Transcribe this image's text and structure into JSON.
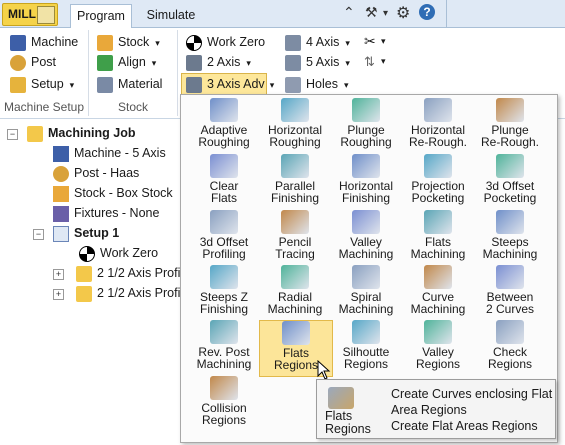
{
  "app": {
    "button_label": "MILL"
  },
  "tabs": [
    {
      "label": "Program"
    },
    {
      "label": "Simulate"
    }
  ],
  "ribbon": {
    "machine_setup": {
      "items": [
        "Machine",
        "Post",
        "Setup"
      ],
      "group_label": "Machine Setup"
    },
    "stock": {
      "items": [
        "Stock",
        "Align",
        "Material"
      ],
      "group_label": "Stock"
    },
    "toolpaths": {
      "work_zero": "Work Zero",
      "two_axis": "2 Axis",
      "three_axis_adv": "3 Axis Adv",
      "four_axis": "4 Axis",
      "five_axis": "5 Axis",
      "holes": "Holes"
    }
  },
  "tree": {
    "root": "Machining Job",
    "items": [
      "Machine - 5 Axis",
      "Post - Haas",
      "Stock - Box Stock",
      "Fixtures - None"
    ],
    "setup": "Setup 1",
    "setup_items": [
      "Work Zero",
      "2 1/2 Axis Profil",
      "2 1/2 Axis Profil"
    ]
  },
  "dropdown": {
    "items": [
      [
        "Adaptive\nRoughing",
        "Horizontal\nRoughing",
        "Plunge\nRoughing",
        "Horizontal\nRe-Rough.",
        "Plunge\nRe-Rough."
      ],
      [
        "Clear\nFlats",
        "Parallel\nFinishing",
        "Horizontal\nFinishing",
        "Projection\nPocketing",
        "3d Offset\nPocketing"
      ],
      [
        "3d Offset\nProfiling",
        "Pencil\nTracing",
        "Valley\nMachining",
        "Flats\nMachining",
        "Steeps\nMachining"
      ],
      [
        "Steeps Z\nFinishing",
        "Radial\nMachining",
        "Spiral\nMachining",
        "Curve\nMachining",
        "Between\n2 Curves"
      ],
      [
        "Rev. Post\nMachining",
        "Flats\nRegions",
        "Silhoutte\nRegions",
        "Valley\nRegions",
        "Check\nRegions"
      ],
      [
        "Collision\nRegions"
      ]
    ],
    "selected": "Flats\nRegions"
  },
  "tooltip": {
    "title": "Flats\nRegions",
    "lines": [
      "Create Curves enclosing Flat",
      "Area Regions",
      "Create Flat Areas Regions"
    ]
  },
  "colors": {
    "accent": "#f5d34a",
    "highlight": "#fce599",
    "tab_bg": "#dfe9f5"
  }
}
